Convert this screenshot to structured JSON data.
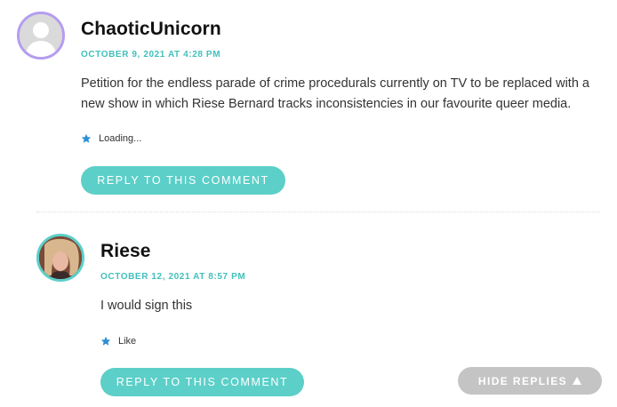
{
  "comments": [
    {
      "author": "ChaoticUnicorn",
      "date": "OCTOBER 9, 2021 AT 4:28 PM",
      "text": "Petition for the endless parade of crime procedurals currently on TV to be replaced with a new show in which Riese Bernard tracks inconsistencies in our favourite queer media.",
      "like_label": "Loading...",
      "reply_label": "REPLY TO THIS COMMENT"
    },
    {
      "author": "Riese",
      "date": "OCTOBER 12, 2021 AT 8:57 PM",
      "text": "I would sign this",
      "like_label": "Like",
      "reply_label": "REPLY TO THIS COMMENT"
    }
  ],
  "hide_replies_label": "HIDE REPLIES",
  "colors": {
    "accent": "#5ccfc8",
    "date": "#41c1bb",
    "star": "#2e8fd4",
    "avatar_ring_1": "#b49cf0",
    "avatar_ring_2": "#5ccfc8",
    "hide_button": "#c4c4c4"
  },
  "icons": {
    "default_avatar": "default-avatar-icon",
    "like": "star-icon",
    "hide": "triangle-up-icon"
  }
}
